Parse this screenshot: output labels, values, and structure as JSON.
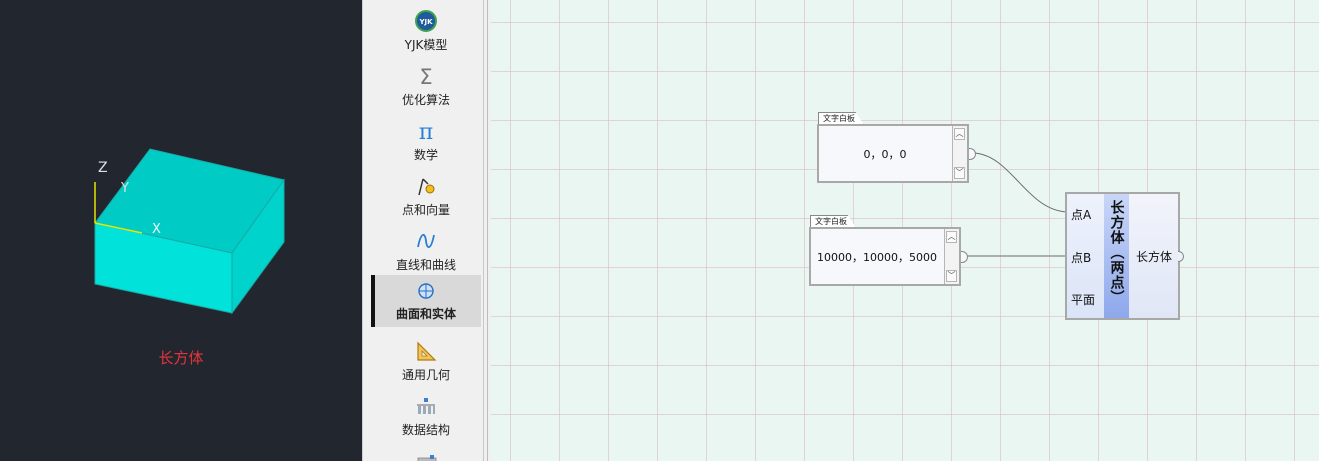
{
  "viewport": {
    "caption": "长方体",
    "axis_labels": {
      "z": "Z",
      "y": "Y",
      "x": "X"
    },
    "box_color": "#00dfd8"
  },
  "toolbox": {
    "items": [
      {
        "label": "YJK模型",
        "icon": "yjk-logo-icon"
      },
      {
        "label": "优化算法",
        "icon": "sigma-icon"
      },
      {
        "label": "数学",
        "icon": "pi-icon"
      },
      {
        "label": "点和向量",
        "icon": "point-vector-icon"
      },
      {
        "label": "直线和曲线",
        "icon": "curve-icon"
      },
      {
        "label": "曲面和实体",
        "icon": "surface-solid-icon",
        "active": true
      },
      {
        "label": "通用几何",
        "icon": "triangle-ruler-icon"
      },
      {
        "label": "数据结构",
        "icon": "data-structure-icon"
      }
    ]
  },
  "canvas": {
    "panel1": {
      "tab": "文字白板",
      "value": "0，0，0"
    },
    "panel2": {
      "tab": "文字白板",
      "value": "10000，10000，5000"
    },
    "component": {
      "title": "长方体（两点）",
      "inputs": [
        "点A",
        "点B",
        "平面"
      ],
      "output": "长方体"
    }
  }
}
